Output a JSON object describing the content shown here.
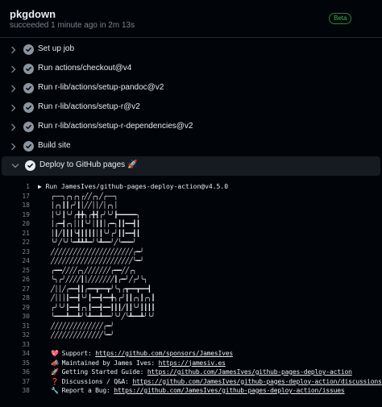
{
  "header": {
    "title": "pkgdown",
    "subtitle": "succeeded 1 minute ago in 2m 13s",
    "badge": "Beta"
  },
  "steps": [
    {
      "label": "Set up job",
      "expanded": false
    },
    {
      "label": "Run actions/checkout@v4",
      "expanded": false
    },
    {
      "label": "Run r-lib/actions/setup-pandoc@v2",
      "expanded": false
    },
    {
      "label": "Run r-lib/actions/setup-r@v2",
      "expanded": false
    },
    {
      "label": "Run r-lib/actions/setup-r-dependencies@v2",
      "expanded": false
    },
    {
      "label": "Build site",
      "expanded": false
    },
    {
      "label": "Deploy to GitHub pages 🚀",
      "expanded": true
    }
  ],
  "log": {
    "run_line": {
      "num": "1",
      "text": "▶ Run JamesIves/github-pages-deploy-action@v4.5.0"
    },
    "ascii_lines": [
      {
        "num": "17",
        "text": "╭──╮╭╮╭╮╭╱╱╭╮╱╭──╮"
      },
      {
        "num": "18",
        "text": "│╭╮┃┃╭╯┃│╱╱││╱│╭╮│"
      },
      {
        "num": "19",
        "text": "│╰╯┃╰╯╭╋╋╮╭╋┫╭╯╰╯┣━━━━━╮"
      },
      {
        "num": "20",
        "text": "│╭━┫╭╮││┃╰╯│┃┃│╭━╮┃┃━━┫┃"
      },
      {
        "num": "21",
        "text": "│┃╱┃┃┃╰┫┃┃┃┃│┃╰╯╭╯┃┃━━┫┃"
      },
      {
        "num": "22",
        "text": "╰╯╱╰╯╰━┻┻┻━╯╰┻━━╯╱╰━━━╯"
      },
      {
        "num": "23",
        "text": "╱╱╱╱╱╱╱╱╱╱╱╱╱╱╱╱╱╱╱╱╱╱╭━╯"
      },
      {
        "num": "24",
        "text": "╱╱╱╱╱╱╱╱╱╱╱╱╱╱╱╱╱╱╱╱╱╱╰━╯"
      },
      {
        "num": "25",
        "text": "╭━━╱╱╱╱╭╮╱╱╱╱╱╱╱╭━━╱╱╭╮"
      },
      {
        "num": "26",
        "text": "╰╮╭╯╱╱╱╱┃│╱╱╱╱╱╱╱┃╭━╯╱╭╯╰╮"
      },
      {
        "num": "27",
        "text": "╱││╱╭━━┫┃╭━━┳━━┳╯╰╮╭┳━━┳━━┫"
      },
      {
        "num": "28",
        "text": "╱│││┃━━┫╰╯┃━━┫━━╋╮╭╯┃┃╭╮┃╭╮┃"
      },
      {
        "num": "29",
        "text": "╭╯╰╯┃━━┫╭╮┃━━┫━━┃┃┃╱┃┃╰╯┃┃┃┃"
      },
      {
        "num": "30",
        "text": "╰━━━┻━━┻╯╰┻━━┻━━╯╰╯╱╰┻━━┻╯╰╯"
      },
      {
        "num": "31",
        "text": "╱╱╱╱╱╱╱╱╱╱╱╱╱╱╭━╯"
      },
      {
        "num": "32",
        "text": "╱╱╱╱╱╱╱╱╱╱╱╱╱╱╰━╯"
      }
    ],
    "blank_line": {
      "num": "33",
      "text": ""
    },
    "info_lines": [
      {
        "num": "34",
        "emoji": "💖",
        "label": "Support: ",
        "link": "https://github.com/sponsors/JamesIves"
      },
      {
        "num": "35",
        "emoji": "📣",
        "label": "Maintained by James Ives: ",
        "link": "https://jamesiv.es"
      },
      {
        "num": "36",
        "emoji": "🚀",
        "label": "Getting Started Guide: ",
        "link": "https://github.com/JamesIves/github-pages-deploy-action"
      },
      {
        "num": "37",
        "emoji": "❓",
        "label": "Discussions / Q&A: ",
        "link": "https://github.com/JamesIves/github-pages-deploy-action/discussions"
      },
      {
        "num": "38",
        "emoji": "🔧",
        "label": "Report a Bug: ",
        "link": "https://github.com/JamesIves/github-pages-deploy-action/issues"
      }
    ]
  },
  "colors": {
    "background": "#010409",
    "text": "#e6edf3",
    "muted": "#7d8590",
    "badge_green": "#3fb950"
  }
}
